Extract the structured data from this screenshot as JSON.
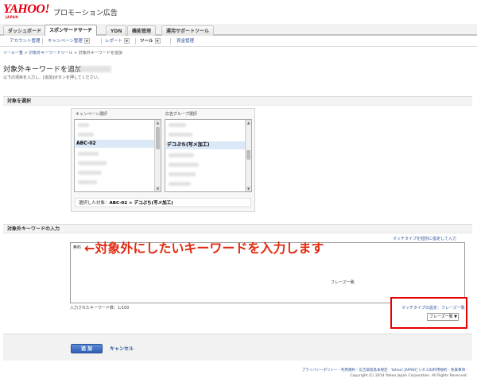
{
  "header": {
    "logo_text": "YAHOO!",
    "logo_sub": "JAPAN",
    "brand": "プロモーション広告"
  },
  "tabs": [
    {
      "label": "ダッシュボード"
    },
    {
      "label": "スポンサードサーチ"
    },
    {
      "label": "YDN"
    },
    {
      "label": "機能管理"
    },
    {
      "label": "運用サポートツール"
    }
  ],
  "subnav": {
    "account": "アカウント管理",
    "campaign": "キャンペーン管理",
    "report": "レポート",
    "tool": "ツール",
    "assets": "資金管理",
    "dropdown_glyph": "▼"
  },
  "breadcrumb": {
    "root": "ツール一覧",
    "parent": "対象外キーワードツール",
    "current": "対象外キーワードを追加",
    "separator": ">"
  },
  "page": {
    "title": "対象外キーワードを追加",
    "description": "以下の項目を入力し、[追加]ボタンを押してください。"
  },
  "target_section": {
    "heading": "対象を選択",
    "campaign_label": "キャンペーン選択",
    "adgroup_label": "広告グループ選択",
    "campaign_selected": "ABC-02",
    "adgroup_selected": "デコぷち(写メ加工)",
    "selected_prefix": "選択した対象：",
    "selected_path": "ABC-02 > デコぷち(写メ加工)"
  },
  "keyword_section": {
    "heading": "対象外キーワードの入力",
    "match_type_link": "マッチタイプを個別に指定して入力",
    "textarea_first_word": "無料",
    "textarea_match_label": "フレーズ一致",
    "annotation": "←対象外にしたいキーワードを入力します",
    "count_label": "入力されたキーワード数：",
    "count_value": "1/100",
    "match_setting_label": "マッチタイプの設定：フレーズ一致",
    "match_select_value": "フレーズ一致"
  },
  "actions": {
    "add": "追 加",
    "cancel": "キャンセル"
  },
  "footer": {
    "links": "プライバシーポリシー - 利用規約 - 広告取扱基本規定 - Yahoo! JAPANビジネスID利用規約 - 免責事項 -",
    "copyright": "Copyright (C) 2014 Yahoo Japan Corporation. All Rights Reserved."
  },
  "colors": {
    "brand_red": "#e60012",
    "link_blue": "#335599",
    "annotation_red": "#e02a10",
    "highlight_box": "#e60000"
  }
}
